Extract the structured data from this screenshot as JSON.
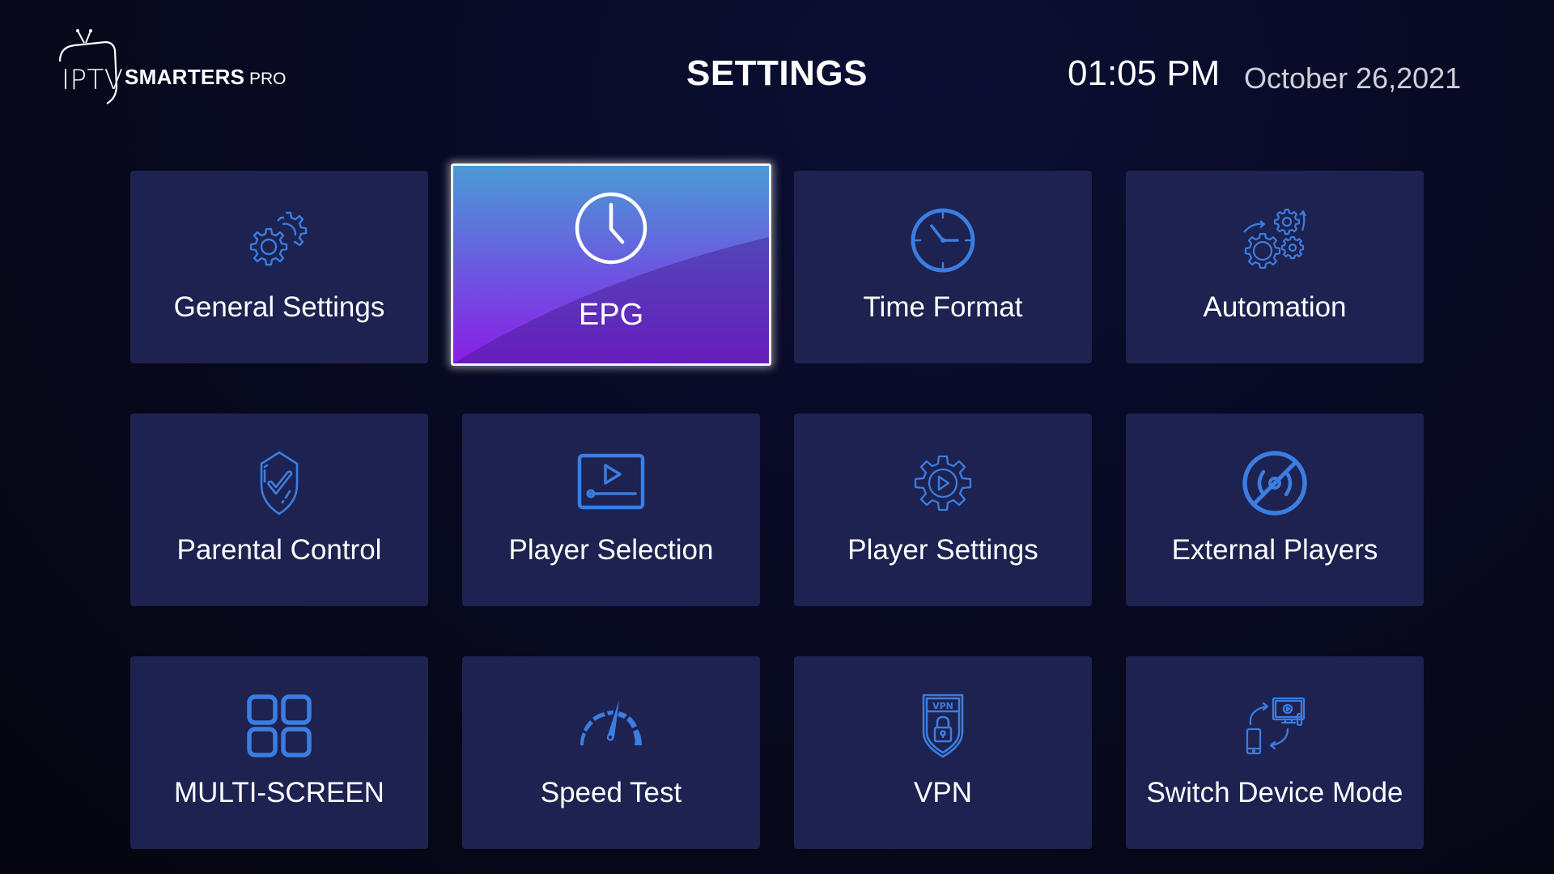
{
  "header": {
    "logo": {
      "prefix": "IPTV",
      "brand": "SMARTERS",
      "suffix": "PRO"
    },
    "title": "SETTINGS",
    "time": "01:05 PM",
    "date": "October 26,2021"
  },
  "colors": {
    "accent_icon": "#3b7de0",
    "tile_bg": "#1d2250",
    "focus_gradient_top": "#4a9ad4",
    "focus_gradient_bottom": "#8a1ee6"
  },
  "tiles": [
    {
      "label": "General Settings",
      "icon": "gears-icon",
      "focused": false
    },
    {
      "label": "EPG",
      "icon": "clock-icon",
      "focused": true
    },
    {
      "label": "Time Format",
      "icon": "clock-icon",
      "focused": false
    },
    {
      "label": "Automation",
      "icon": "automation-gears-icon",
      "focused": false
    },
    {
      "label": "Parental Control",
      "icon": "shield-check-icon",
      "focused": false
    },
    {
      "label": "Player Selection",
      "icon": "video-player-icon",
      "focused": false
    },
    {
      "label": "Player Settings",
      "icon": "gear-play-icon",
      "focused": false
    },
    {
      "label": "External Players",
      "icon": "disc-slash-icon",
      "focused": false
    },
    {
      "label": "MULTI-SCREEN",
      "icon": "grid-icon",
      "focused": false
    },
    {
      "label": "Speed Test",
      "icon": "speedometer-icon",
      "focused": false
    },
    {
      "label": "VPN",
      "icon": "vpn-shield-icon",
      "focused": false
    },
    {
      "label": "Switch Device Mode",
      "icon": "switch-device-icon",
      "focused": false
    }
  ]
}
